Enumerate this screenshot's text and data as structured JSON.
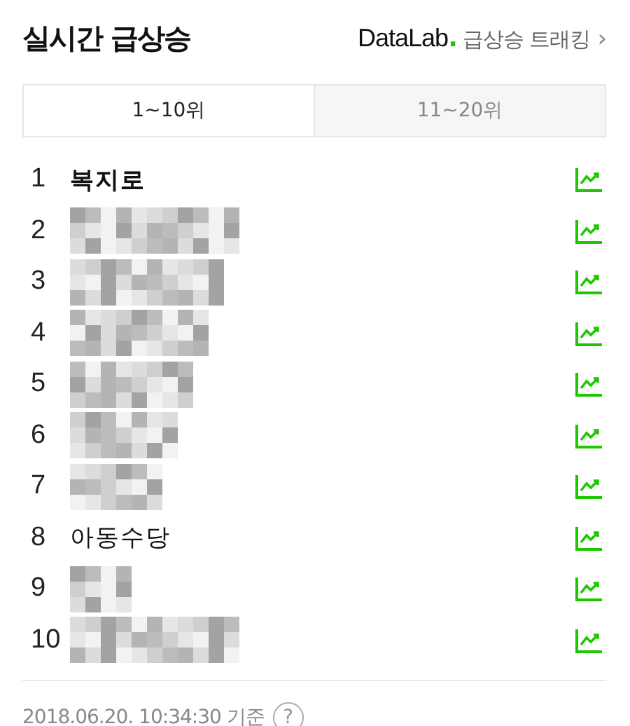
{
  "header": {
    "title": "실시간 급상승",
    "link": {
      "brand": "DataLab",
      "brand_dot": ".",
      "label": "급상승 트래킹",
      "chevron": "›"
    }
  },
  "tabs": [
    {
      "label": "1~10위",
      "selected": true
    },
    {
      "label": "11~20위",
      "selected": false
    }
  ],
  "ranking": [
    {
      "rank": "1",
      "kind": "text",
      "keyword": "복지로",
      "bold": true
    },
    {
      "rank": "2",
      "kind": "blurred"
    },
    {
      "rank": "3",
      "kind": "blurred"
    },
    {
      "rank": "4",
      "kind": "blurred"
    },
    {
      "rank": "5",
      "kind": "blurred"
    },
    {
      "rank": "6",
      "kind": "blurred"
    },
    {
      "rank": "7",
      "kind": "blurred"
    },
    {
      "rank": "8",
      "kind": "text",
      "keyword": "아동수당",
      "bold": false
    },
    {
      "rank": "9",
      "kind": "blurred"
    },
    {
      "rank": "10",
      "kind": "blurred"
    }
  ],
  "footer": {
    "timestamp": "2018.06.20. 10:34:30 기준",
    "help": "?"
  }
}
